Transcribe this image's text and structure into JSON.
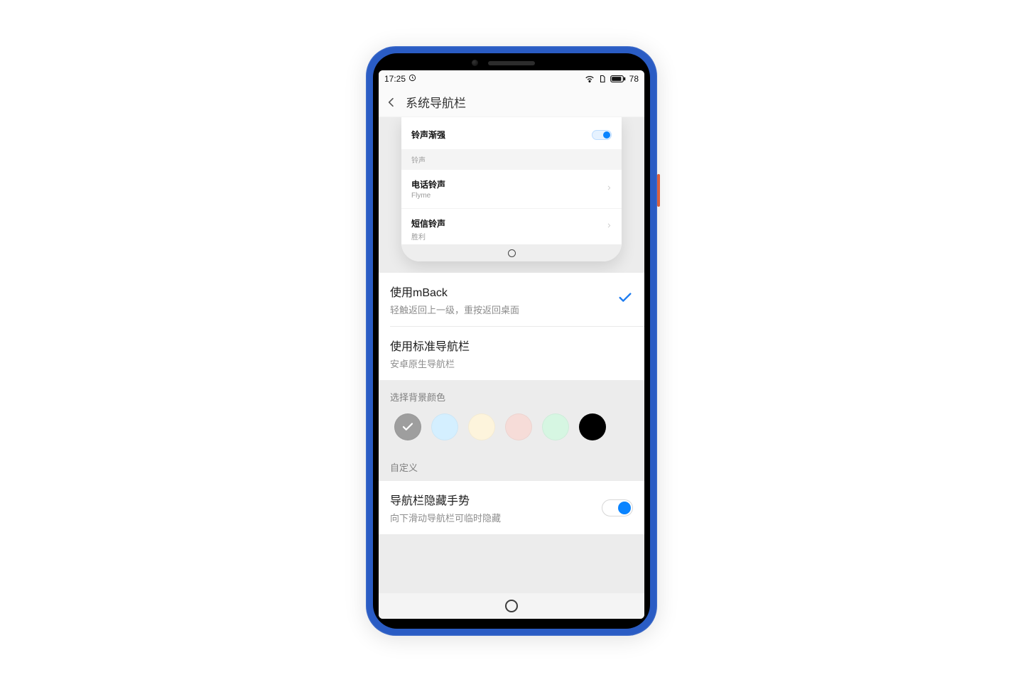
{
  "status": {
    "time": "17:25",
    "battery": "78"
  },
  "header": {
    "title": "系统导航栏"
  },
  "preview": {
    "toggle_row": {
      "label": "铃声渐强"
    },
    "section": "铃声",
    "row1": {
      "label": "电话铃声",
      "sub": "Flyme"
    },
    "row2": {
      "label": "短信铃声",
      "sub": "胜利"
    }
  },
  "options": {
    "mback": {
      "title": "使用mBack",
      "sub": "轻触返回上一级，重按返回桌面"
    },
    "standard": {
      "title": "使用标准导航栏",
      "sub": "安卓原生导航栏"
    }
  },
  "colors": {
    "header": "选择背景颜色",
    "swatches": [
      "#9e9e9e",
      "#d4efff",
      "#fdf4dc",
      "#f6dcd8",
      "#d6f6e2",
      "#000000"
    ],
    "selected_index": 0
  },
  "custom": {
    "header": "自定义"
  },
  "gesture": {
    "title": "导航栏隐藏手势",
    "sub": "向下滑动导航栏可临时隐藏"
  }
}
